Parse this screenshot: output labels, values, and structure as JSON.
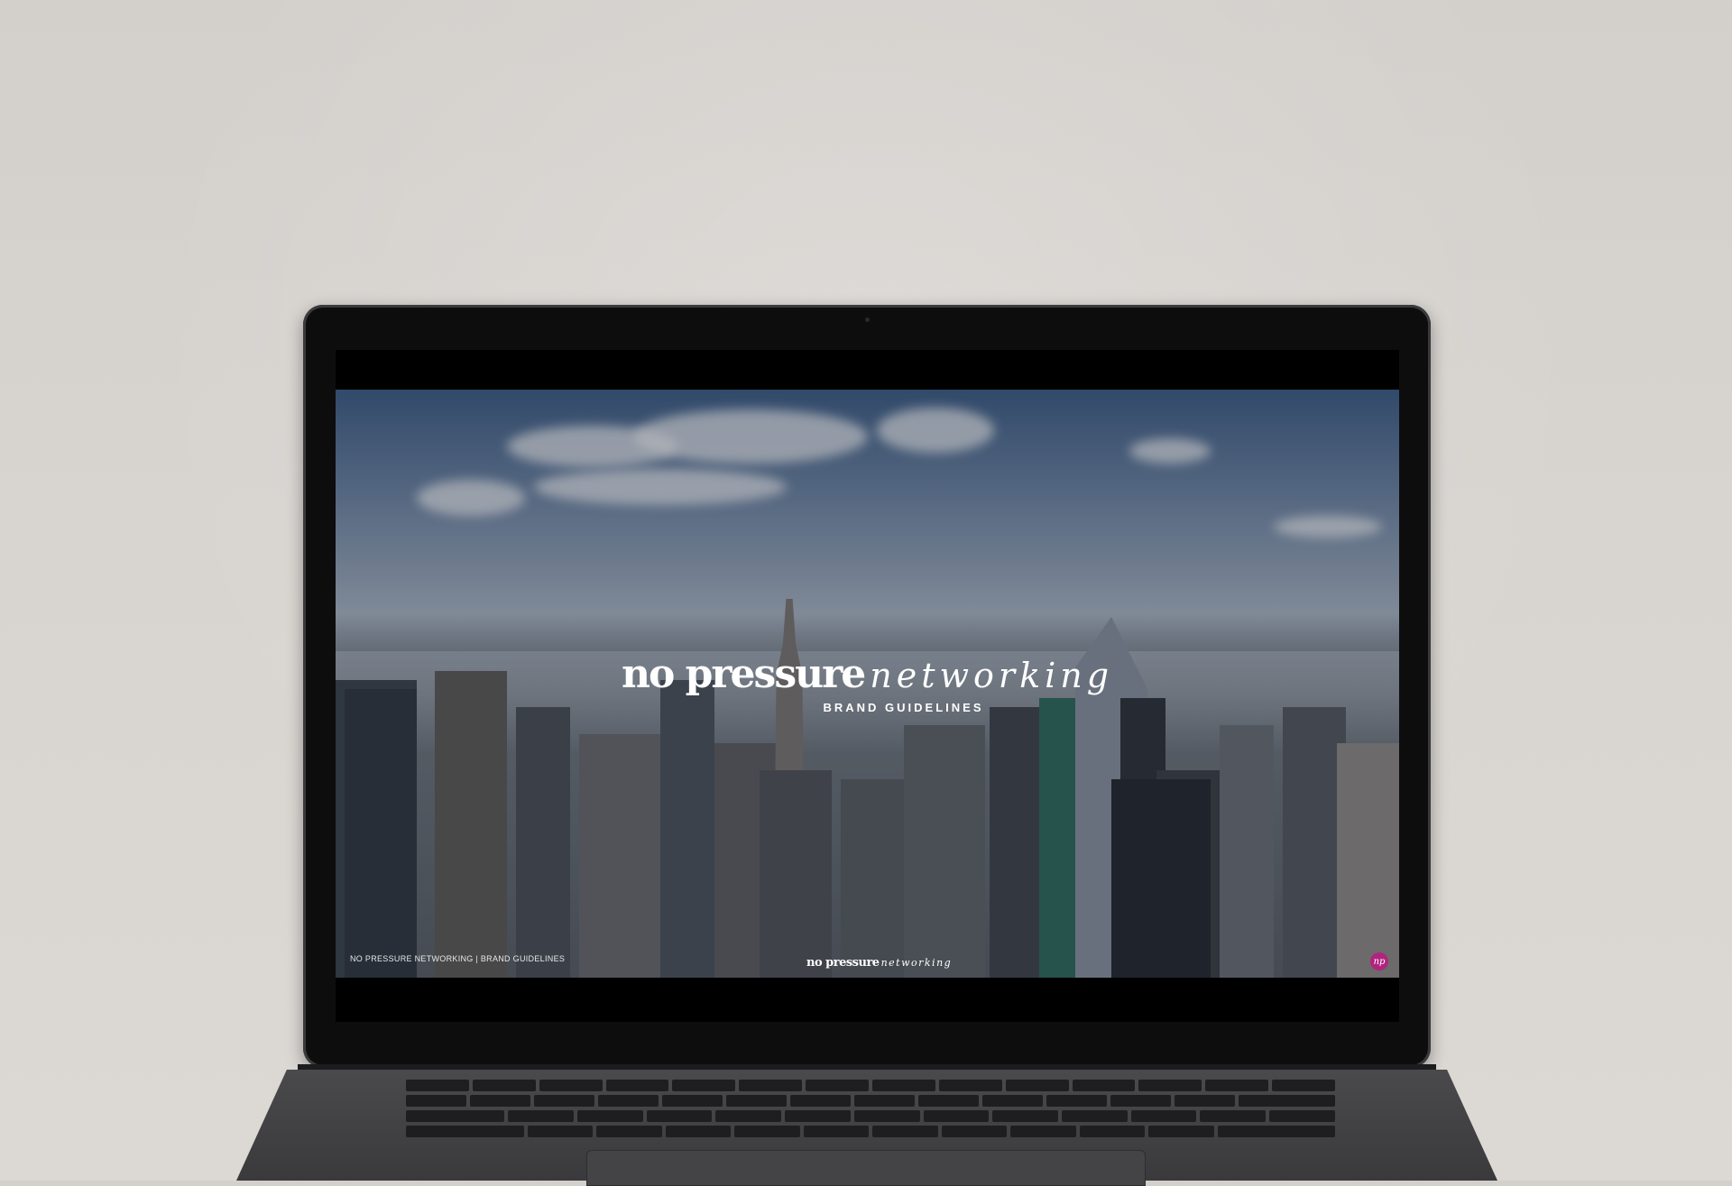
{
  "slide": {
    "logo_bold": "no pressure",
    "logo_script": "networking",
    "subtitle": "BRAND GUIDELINES",
    "footer_text": "NO PRESSURE NETWORKING | BRAND GUIDELINES",
    "footer_logo_bold": "no pressure",
    "footer_logo_script": "networking",
    "badge_text": "np"
  },
  "colors": {
    "badge": "#b0247f",
    "wall": "#d8d4d0",
    "bezel": "#0d0d0e"
  }
}
